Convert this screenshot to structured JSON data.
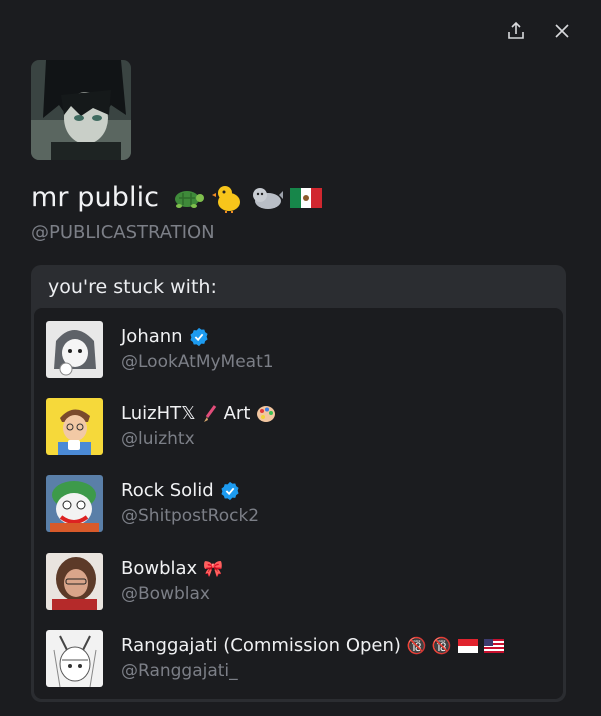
{
  "profile": {
    "display_name": "mr public",
    "handle": "@PUBLICASTRATION",
    "name_emojis": [
      "turtle-emoji",
      "chick-emoji",
      "seal-emoji",
      "mexico-flag-emoji"
    ]
  },
  "card": {
    "title": "you're stuck with:"
  },
  "accounts": [
    {
      "name": "Johann",
      "handle": "@LookAtMyMeat1",
      "verified": true,
      "suffix": ""
    },
    {
      "name": "LuizHT𝕏",
      "handle": "@luizhtx",
      "verified": false,
      "suffix_text": "Art"
    },
    {
      "name": "Rock Solid",
      "handle": "@ShitpostRock2",
      "verified": true,
      "suffix": ""
    },
    {
      "name": "Bowblax",
      "handle": "@Bowblax",
      "verified": false,
      "suffix": "🎀"
    },
    {
      "name": "Ranggajati (Commission Open)",
      "handle": "@Ranggajati_",
      "verified": false,
      "suffix": "🔞 🔞"
    }
  ],
  "colors": {
    "background": "#1b1c1f",
    "card": "#2b2d31",
    "verified": "#1d9bf0",
    "muted_text": "#7c7f87"
  }
}
